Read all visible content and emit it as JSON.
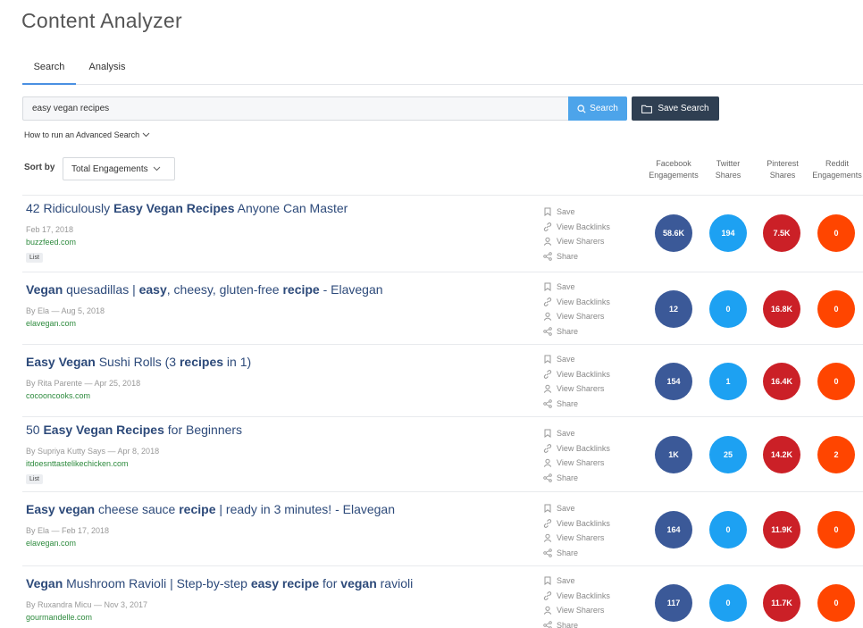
{
  "page_title": "Content Analyzer",
  "tabs": [
    {
      "label": "Search"
    },
    {
      "label": "Analysis"
    }
  ],
  "search": {
    "value": "easy vegan recipes",
    "button_label": "Search",
    "save_label": "Save Search"
  },
  "advanced_link": "How to run an Advanced Search",
  "sort": {
    "label": "Sort by",
    "selected": "Total Engagements"
  },
  "columns": [
    {
      "line1": "Facebook",
      "line2": "Engagements"
    },
    {
      "line1": "Twitter",
      "line2": "Shares"
    },
    {
      "line1": "Pinterest",
      "line2": "Shares"
    },
    {
      "line1": "Reddit",
      "line2": "Engagements"
    }
  ],
  "actions": {
    "save": "Save",
    "backlinks": "View Backlinks",
    "sharers": "View Sharers",
    "share": "Share"
  },
  "colors": {
    "facebook": "#3b5998",
    "twitter": "#1da1f2",
    "pinterest": "#cb2027",
    "reddit": "#ff4500",
    "link": "#2d4a7a",
    "domain": "#2e8b3e",
    "search_button": "#4da4ea",
    "save_button": "#2f3f52"
  },
  "results": [
    {
      "title_parts": [
        {
          "t": "42 Ridiculously ",
          "b": false
        },
        {
          "t": "Easy Vegan Recipes",
          "b": true
        },
        {
          "t": " Anyone Can Master",
          "b": false
        }
      ],
      "meta": "Feb 17, 2018",
      "domain": "buzzfeed.com",
      "tag": "List",
      "facebook": "58.6K",
      "twitter": "194",
      "pinterest": "7.5K",
      "reddit": "0"
    },
    {
      "title_parts": [
        {
          "t": "Vegan",
          "b": true
        },
        {
          "t": " quesadillas | ",
          "b": false
        },
        {
          "t": "easy",
          "b": true
        },
        {
          "t": ", cheesy, gluten-free ",
          "b": false
        },
        {
          "t": "recipe",
          "b": true
        },
        {
          "t": " - Elavegan",
          "b": false
        }
      ],
      "meta": "By Ela — Aug 5, 2018",
      "domain": "elavegan.com",
      "tag": "",
      "facebook": "12",
      "twitter": "0",
      "pinterest": "16.8K",
      "reddit": "0"
    },
    {
      "title_parts": [
        {
          "t": "Easy Vegan",
          "b": true
        },
        {
          "t": " Sushi Rolls (3 ",
          "b": false
        },
        {
          "t": "recipes",
          "b": true
        },
        {
          "t": " in 1)",
          "b": false
        }
      ],
      "meta": "By Rita Parente — Apr 25, 2018",
      "domain": "cocooncooks.com",
      "tag": "",
      "facebook": "154",
      "twitter": "1",
      "pinterest": "16.4K",
      "reddit": "0"
    },
    {
      "title_parts": [
        {
          "t": "50 ",
          "b": false
        },
        {
          "t": "Easy Vegan Recipes",
          "b": true
        },
        {
          "t": " for Beginners",
          "b": false
        }
      ],
      "meta": "By Supriya Kutty Says — Apr 8, 2018",
      "domain": "itdoesnttastelikechicken.com",
      "tag": "List",
      "facebook": "1K",
      "twitter": "25",
      "pinterest": "14.2K",
      "reddit": "2"
    },
    {
      "title_parts": [
        {
          "t": "Easy vegan",
          "b": true
        },
        {
          "t": " cheese sauce ",
          "b": false
        },
        {
          "t": "recipe",
          "b": true
        },
        {
          "t": " | ready in 3 minutes! - Elavegan",
          "b": false
        }
      ],
      "meta": "By Ela — Feb 17, 2018",
      "domain": "elavegan.com",
      "tag": "",
      "facebook": "164",
      "twitter": "0",
      "pinterest": "11.9K",
      "reddit": "0"
    },
    {
      "title_parts": [
        {
          "t": "Vegan",
          "b": true
        },
        {
          "t": " Mushroom Ravioli | Step-by-step ",
          "b": false
        },
        {
          "t": "easy recipe",
          "b": true
        },
        {
          "t": " for ",
          "b": false
        },
        {
          "t": "vegan",
          "b": true
        },
        {
          "t": " ravioli",
          "b": false
        }
      ],
      "meta": "By Ruxandra Micu — Nov 3, 2017",
      "domain": "gourmandelle.com",
      "tag": "",
      "facebook": "117",
      "twitter": "0",
      "pinterest": "11.7K",
      "reddit": "0"
    }
  ]
}
